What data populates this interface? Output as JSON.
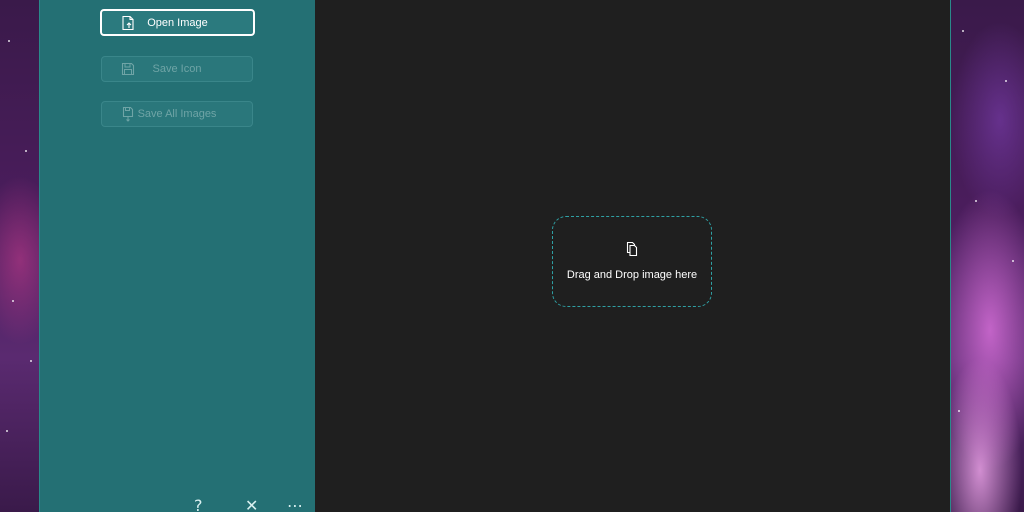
{
  "sidebar": {
    "buttons": [
      {
        "label": "Open Image",
        "icon": "open-file-icon",
        "enabled": true
      },
      {
        "label": "Save Icon",
        "icon": "save-icon",
        "enabled": false
      },
      {
        "label": "Save All Images",
        "icon": "save-all-icon",
        "enabled": false
      }
    ],
    "bottom_icons": [
      "help-icon",
      "close-icon",
      "more-icon"
    ]
  },
  "main": {
    "drop_zone": {
      "text": "Drag and Drop image here",
      "icon": "copy-files-icon"
    }
  },
  "colors": {
    "sidebar_bg": "#247074",
    "main_bg": "#1f1f1f",
    "accent": "#2fa0a4"
  }
}
